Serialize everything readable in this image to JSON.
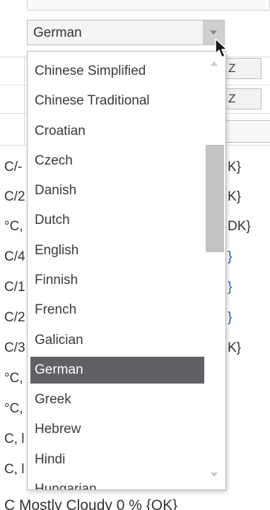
{
  "language_select": {
    "value": "German"
  },
  "dropdown": {
    "options": [
      "Chinese Simplified",
      "Chinese Traditional",
      "Croatian",
      "Czech",
      "Danish",
      "Dutch",
      "English",
      "Finnish",
      "French",
      "Galician",
      "German",
      "Greek",
      "Hebrew",
      "Hindi",
      "Hungarian"
    ],
    "selected": "German"
  },
  "background": {
    "box_labels": [
      "Z",
      "Z"
    ],
    "rows_left": [
      "C/-",
      "C/2",
      "°C,",
      "C/4",
      "C/1",
      "C/2",
      "C/3",
      "°C,",
      "°C,",
      "C, l",
      "C, l"
    ],
    "rows_right": [
      "K}",
      "K}",
      "DK}",
      "}",
      "}",
      "}",
      "K}"
    ],
    "bottom_row": "C  Mostly Cloudy  0 % {OK}"
  },
  "colors": {
    "selected_bg": "#5f6165",
    "scrollbar": "#c3c3c3",
    "link_blue": "#2b62c4"
  }
}
